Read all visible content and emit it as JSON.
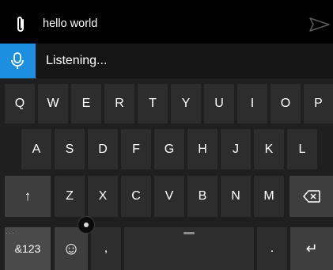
{
  "message_bar": {
    "text": "hello world",
    "attach_icon": "paperclip-icon",
    "send_icon": "send-arrow-icon"
  },
  "dictation": {
    "status": "Listening...",
    "icon": "microphone-icon",
    "accent_color": "#1d8fe0"
  },
  "keyboard": {
    "row1": [
      "Q",
      "W",
      "E",
      "R",
      "T",
      "Y",
      "U",
      "I",
      "O",
      "P"
    ],
    "row2": [
      "A",
      "S",
      "D",
      "F",
      "G",
      "H",
      "J",
      "K",
      "L"
    ],
    "row3": [
      "Z",
      "X",
      "C",
      "V",
      "B",
      "N",
      "M"
    ],
    "shift_label": "↑",
    "backspace_icon": "backspace-icon",
    "symbols_label": "&123",
    "emoji_label": "☺",
    "comma_label": ",",
    "period_label": ".",
    "enter_label": "↵"
  }
}
